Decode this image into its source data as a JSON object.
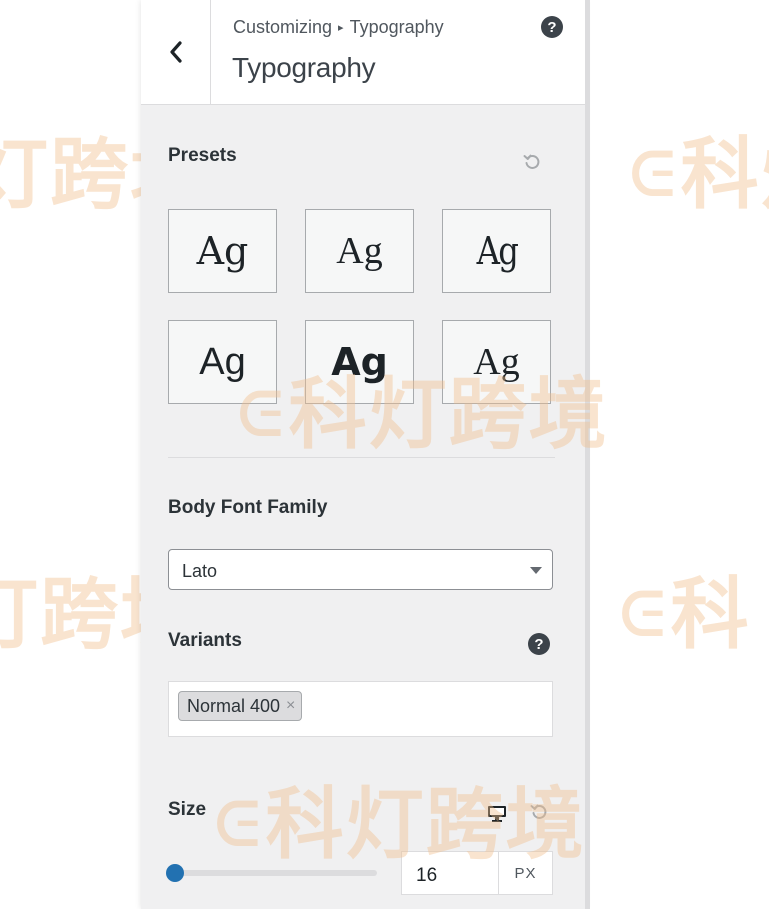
{
  "header": {
    "breadcrumb_parent": "Customizing",
    "breadcrumb_separator": "▸",
    "breadcrumb_current": "Typography",
    "title": "Typography",
    "help_glyph": "?"
  },
  "presets": {
    "label": "Presets",
    "items": [
      {
        "text": "Ag",
        "font": "serif",
        "weight": "normal"
      },
      {
        "text": "Ag",
        "font": "serif",
        "weight": "normal"
      },
      {
        "text": "Ag",
        "font": "serif-condensed",
        "weight": "normal"
      },
      {
        "text": "Ag",
        "font": "sans",
        "weight": "normal"
      },
      {
        "text": "Ag",
        "font": "sans",
        "weight": "bold"
      },
      {
        "text": "Ag",
        "font": "serif",
        "weight": "normal"
      }
    ]
  },
  "body_font": {
    "label": "Body Font Family",
    "value": "Lato"
  },
  "variants": {
    "label": "Variants",
    "help_glyph": "?",
    "tags": [
      {
        "label": "Normal 400",
        "remove": "×"
      }
    ]
  },
  "size": {
    "label": "Size",
    "value": "16",
    "unit": "PX",
    "slider_fraction": 0.0
  },
  "watermark": {
    "text": "科灯跨境",
    "partial_left": "灯跨境",
    "partial_left_2": "灯跨境",
    "partial_right": "科灯",
    "partial_right_2": "科"
  },
  "colors": {
    "accent": "#2271b1",
    "panel_bg": "#f0f0f1",
    "text": "#2c3338"
  }
}
